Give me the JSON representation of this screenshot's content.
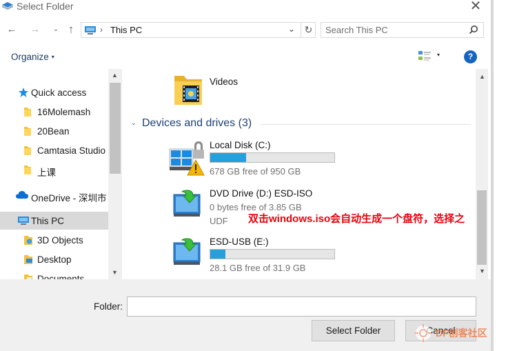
{
  "window": {
    "title": "Select Folder",
    "close_glyph": "✕"
  },
  "navbar": {
    "back_glyph": "←",
    "forward_glyph": "→",
    "recent_glyph": "⌄",
    "up_glyph": "↑",
    "address": {
      "separator": "›",
      "path": "This PC",
      "dropdown_glyph": "⌄",
      "refresh_glyph": "↻"
    },
    "search": {
      "placeholder": "Search This PC"
    }
  },
  "toolbar": {
    "organize_label": "Organize",
    "caret": "▾",
    "view_caret": "▾",
    "help_label": "?"
  },
  "nav_pane": {
    "items": [
      {
        "label": "Quick access",
        "icon": "star-icon"
      },
      {
        "label": "16Molemash",
        "icon": "folder-icon"
      },
      {
        "label": "20Bean",
        "icon": "folder-icon"
      },
      {
        "label": "Camtasia Studio",
        "icon": "folder-icon"
      },
      {
        "label": "上课",
        "icon": "folder-icon"
      },
      {
        "label": "OneDrive - 深圳市",
        "icon": "cloud-icon"
      },
      {
        "label": "This PC",
        "icon": "pc-icon",
        "selected": true
      },
      {
        "label": "3D Objects",
        "icon": "3d-objects-icon"
      },
      {
        "label": "Desktop",
        "icon": "desktop-icon"
      },
      {
        "label": "Documents",
        "icon": "documents-icon"
      }
    ],
    "scroll_up": "▲",
    "scroll_down": "▼"
  },
  "content": {
    "videos": {
      "label": "Videos"
    },
    "group": {
      "chevron": "⌄",
      "title": "Devices and drives (3)"
    },
    "drives": [
      {
        "name": "Local Disk (C:)",
        "free": "678 GB free of 950 GB",
        "used_fraction": 0.29,
        "icon": "windows-drive-locked-icon"
      },
      {
        "name": "DVD Drive (D:) ESD-ISO",
        "free": "0 bytes free of 3.85 GB",
        "filesystem": "UDF",
        "icon": "dvd-drive-icon"
      },
      {
        "name": "ESD-USB (E:)",
        "free": "28.1 GB free of 31.9 GB",
        "used_fraction": 0.12,
        "icon": "usb-drive-icon"
      }
    ],
    "scroll_up": "▲",
    "scroll_down": "▼"
  },
  "annotation": "双击windows.iso会自动生成一个盘符，选择之",
  "bottom": {
    "folder_label": "Folder:",
    "folder_value": "",
    "select_button": "Select Folder",
    "cancel_button": "Cancel"
  },
  "watermark": {
    "brand": "DF创客社区"
  },
  "colors": {
    "accent": "#26a0da",
    "annotation": "#e8000b",
    "help": "#1565c0"
  }
}
